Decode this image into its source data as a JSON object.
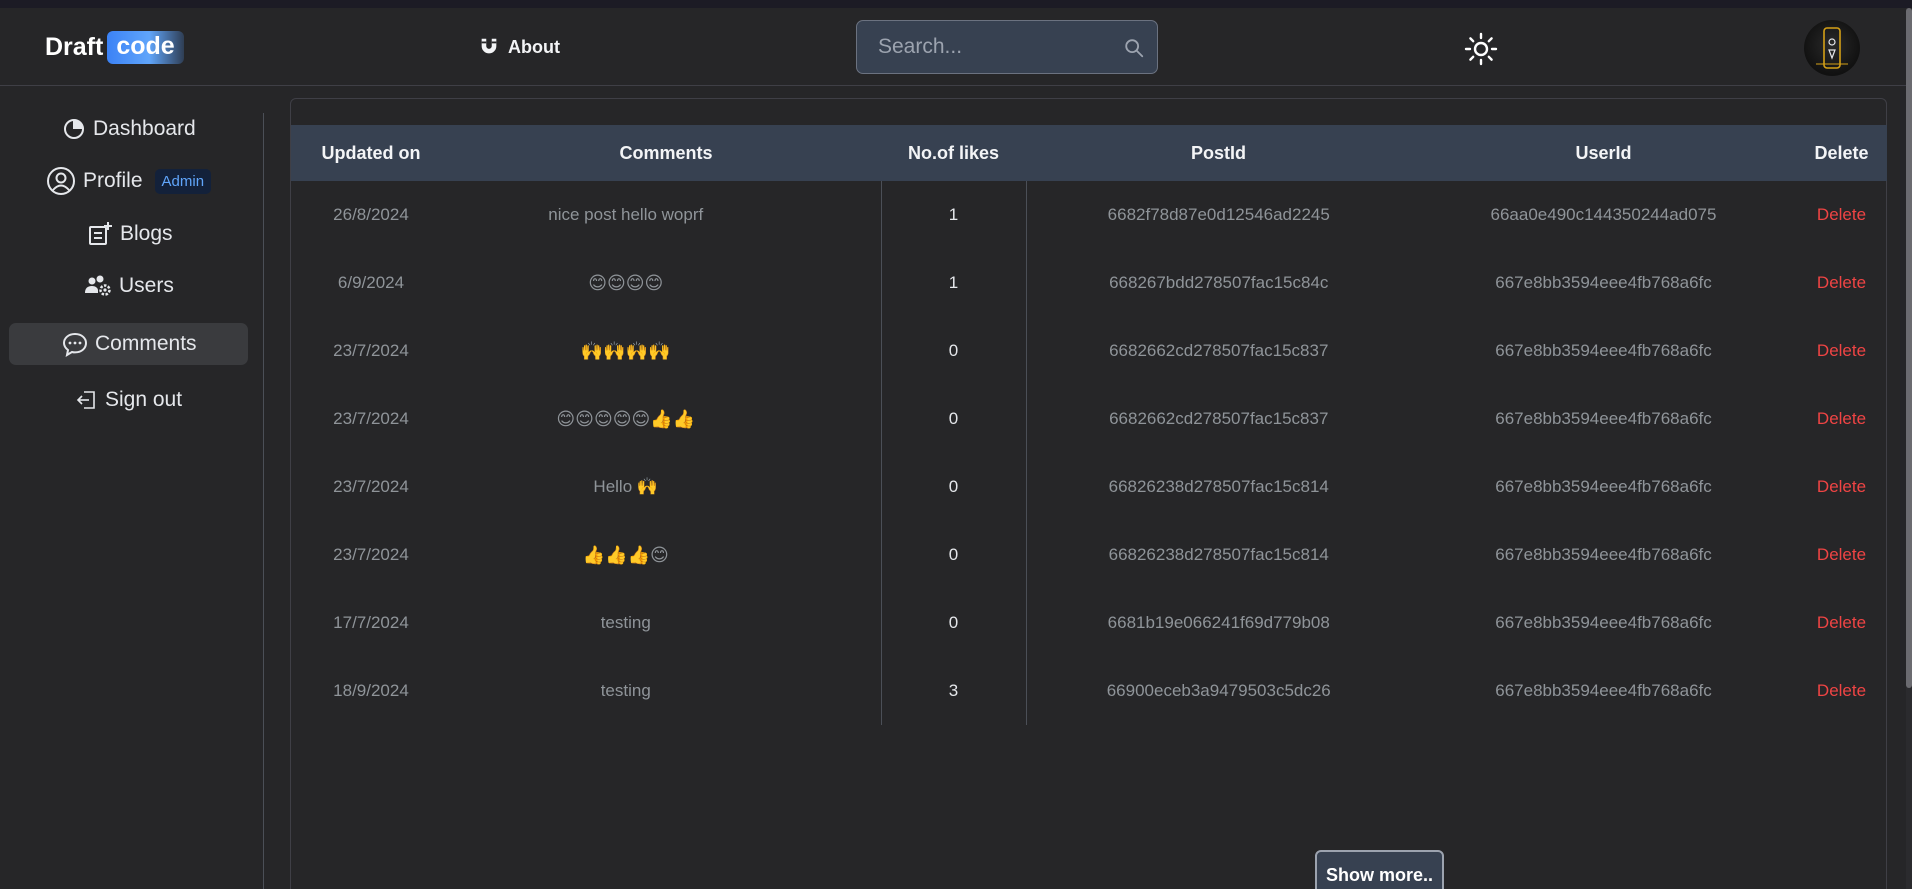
{
  "navbar": {
    "logo_draft": "Draft",
    "logo_code": "code",
    "about_label": "About",
    "search_placeholder": "Search...",
    "theme_icon": "sun-icon",
    "avatar_icon": "user-avatar"
  },
  "sidebar": {
    "items": [
      {
        "label": "Dashboard",
        "icon": "pie-chart-icon"
      },
      {
        "label": "Profile",
        "icon": "user-circle-icon",
        "badge": "Admin"
      },
      {
        "label": "Blogs",
        "icon": "add-post-icon"
      },
      {
        "label": "Users",
        "icon": "users-gear-icon"
      },
      {
        "label": "Comments",
        "icon": "chat-bubble-icon",
        "active": true
      },
      {
        "label": "Sign out",
        "icon": "sign-out-icon"
      }
    ]
  },
  "table": {
    "headers": [
      "Updated on",
      "Comments",
      "No.of likes",
      "PostId",
      "UserId",
      "Delete"
    ],
    "rows": [
      {
        "updated": "26/8/2024",
        "comment": "nice post hello woprf",
        "likes": "1",
        "postId": "6682f78d87e0d12546ad2245",
        "userId": "66aa0e490c144350244ad075",
        "action": "Delete"
      },
      {
        "updated": "6/9/2024",
        "comment": "😊😊😊😊",
        "likes": "1",
        "postId": "668267bdd278507fac15c84c",
        "userId": "667e8bb3594eee4fb768a6fc",
        "action": "Delete"
      },
      {
        "updated": "23/7/2024",
        "comment": "🙌🙌🙌🙌",
        "likes": "0",
        "postId": "6682662cd278507fac15c837",
        "userId": "667e8bb3594eee4fb768a6fc",
        "action": "Delete"
      },
      {
        "updated": "23/7/2024",
        "comment": "😊😊😊😊😊👍👍",
        "likes": "0",
        "postId": "6682662cd278507fac15c837",
        "userId": "667e8bb3594eee4fb768a6fc",
        "action": "Delete"
      },
      {
        "updated": "23/7/2024",
        "comment": "Hello 🙌",
        "likes": "0",
        "postId": "66826238d278507fac15c814",
        "userId": "667e8bb3594eee4fb768a6fc",
        "action": "Delete"
      },
      {
        "updated": "23/7/2024",
        "comment": "👍👍👍😊",
        "likes": "0",
        "postId": "66826238d278507fac15c814",
        "userId": "667e8bb3594eee4fb768a6fc",
        "action": "Delete"
      },
      {
        "updated": "17/7/2024",
        "comment": "testing",
        "likes": "0",
        "postId": "6681b19e066241f69d779b08",
        "userId": "667e8bb3594eee4fb768a6fc",
        "action": "Delete"
      },
      {
        "updated": "18/9/2024",
        "comment": "testing",
        "likes": "3",
        "postId": "66900eceb3a9479503c5dc26",
        "userId": "667e8bb3594eee4fb768a6fc",
        "action": "Delete"
      }
    ]
  },
  "show_more_label": "Show more.."
}
